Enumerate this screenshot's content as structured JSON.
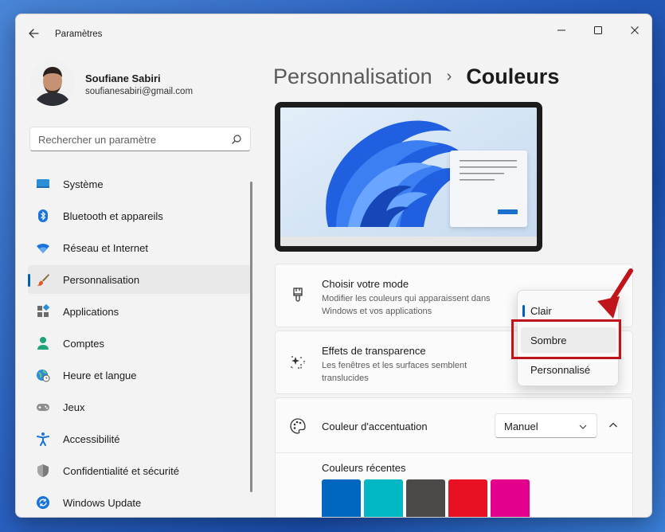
{
  "window": {
    "title": "Paramètres"
  },
  "profile": {
    "name": "Soufiane Sabiri",
    "email": "soufianesabiri@gmail.com"
  },
  "search": {
    "placeholder": "Rechercher un paramètre"
  },
  "nav": {
    "items": [
      {
        "label": "Système",
        "icon": "monitor-icon"
      },
      {
        "label": "Bluetooth et appareils",
        "icon": "bluetooth-icon"
      },
      {
        "label": "Réseau et Internet",
        "icon": "wifi-icon"
      },
      {
        "label": "Personnalisation",
        "icon": "brush-icon",
        "active": true
      },
      {
        "label": "Applications",
        "icon": "apps-icon"
      },
      {
        "label": "Comptes",
        "icon": "person-icon"
      },
      {
        "label": "Heure et langue",
        "icon": "globe-clock-icon"
      },
      {
        "label": "Jeux",
        "icon": "gamepad-icon"
      },
      {
        "label": "Accessibilité",
        "icon": "accessibility-icon"
      },
      {
        "label": "Confidentialité et sécurité",
        "icon": "shield-icon"
      },
      {
        "label": "Windows Update",
        "icon": "update-icon"
      }
    ]
  },
  "breadcrumb": {
    "parent": "Personnalisation",
    "separator": "›",
    "current": "Couleurs"
  },
  "mode": {
    "title": "Choisir votre mode",
    "description": "Modifier les couleurs qui apparaissent dans Windows et vos applications",
    "options": [
      "Clair",
      "Sombre",
      "Personnalisé"
    ],
    "selected": "Clair",
    "hovered": "Sombre"
  },
  "transparency": {
    "title": "Effets de transparence",
    "description": "Les fenêtres et les surfaces semblent translucides"
  },
  "accent": {
    "title": "Couleur d'accentuation",
    "value": "Manuel",
    "recent_label": "Couleurs récentes",
    "recent_colors": [
      "#0067c0",
      "#00b7c3",
      "#4c4a48",
      "#e81123",
      "#e3008c"
    ]
  },
  "colors": {
    "accent": "#005fb8",
    "annotation": "#c0141b"
  }
}
